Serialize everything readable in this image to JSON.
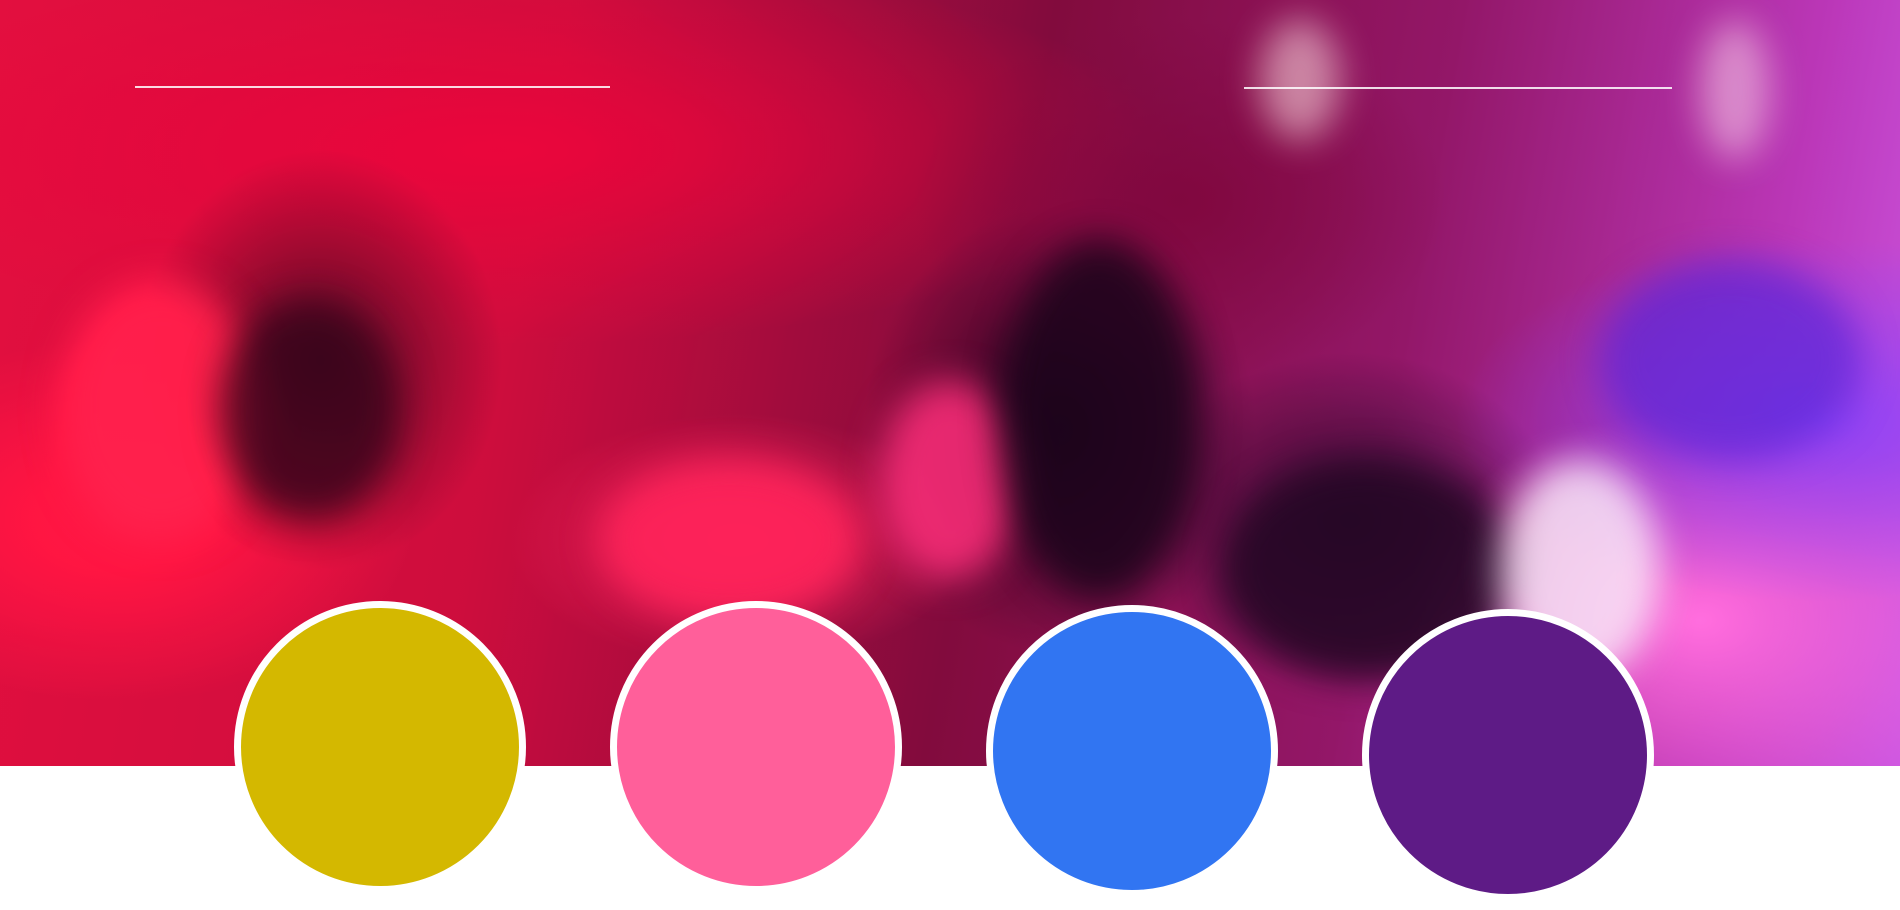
{
  "colors": {
    "circle_1": "#d4b800",
    "circle_2": "#ff5f9a",
    "circle_3": "#3175f2",
    "circle_4": "#5e1b86",
    "page_background": "#ffffff",
    "ring": "#ffffff"
  },
  "hero": {
    "description_icon": "blurred-crowd-photo"
  }
}
